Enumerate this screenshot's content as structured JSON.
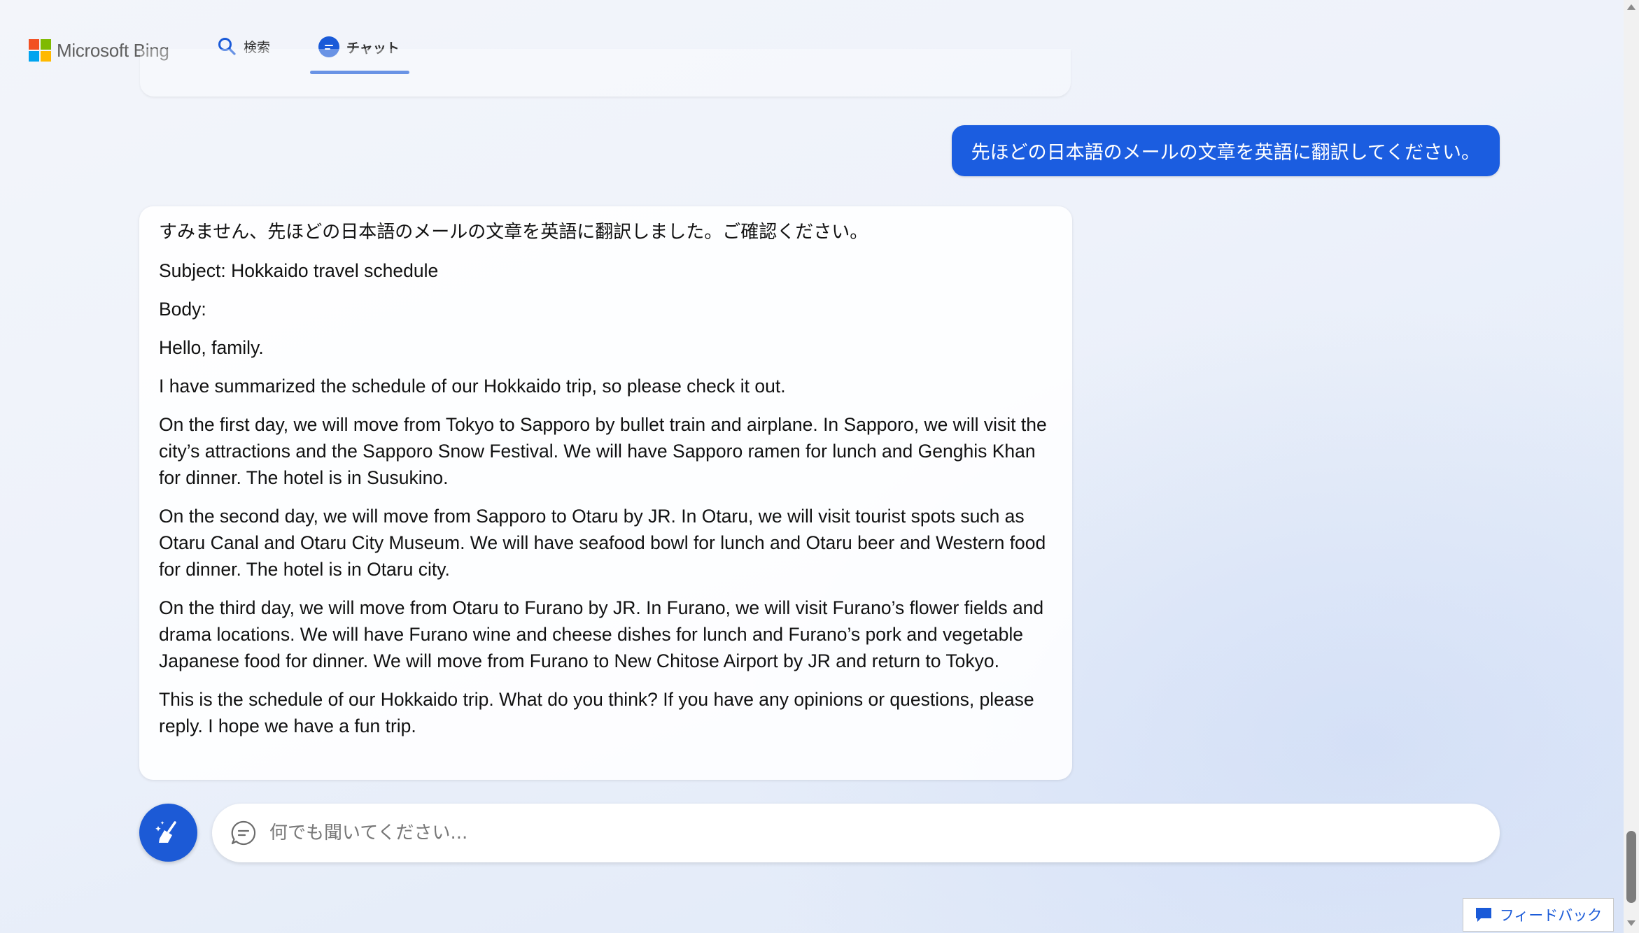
{
  "header": {
    "logo_text": "Microsoft Bing",
    "logo_colors": [
      "#f25022",
      "#7fba00",
      "#00a4ef",
      "#ffb900"
    ],
    "tabs": [
      {
        "label": "検索",
        "icon": "search-icon",
        "active": false
      },
      {
        "label": "チャット",
        "icon": "chat-icon",
        "active": true
      }
    ]
  },
  "conversation": {
    "user_message": "先ほどの日本語のメールの文章を英語に翻訳してください。",
    "bot_response": {
      "intro": "すみません、先ほどの日本語のメールの文章を英語に翻訳しました。ご確認ください。",
      "subject": "Subject: Hokkaido travel schedule",
      "body_label": "Body:",
      "greeting": "Hello, family.",
      "paragraphs": [
        "I have summarized the schedule of our Hokkaido trip, so please check it out.",
        "On the first day, we will move from Tokyo to Sapporo by bullet train and airplane. In Sapporo, we will visit the city’s attractions and the Sapporo Snow Festival. We will have Sapporo ramen for lunch and Genghis Khan for dinner. The hotel is in Susukino.",
        "On the second day, we will move from Sapporo to Otaru by JR. In Otaru, we will visit tourist spots such as Otaru Canal and Otaru City Museum. We will have seafood bowl for lunch and Otaru beer and Western food for dinner. The hotel is in Otaru city.",
        "On the third day, we will move from Otaru to Furano by JR. In Furano, we will visit Furano’s flower fields and drama locations. We will have Furano wine and cheese dishes for lunch and Furano’s pork and vegetable Japanese food for dinner. We will move from Furano to New Chitose Airport by JR and return to Tokyo.",
        "This is the schedule of our Hokkaido trip. What do you think? If you have any opinions or questions, please reply. I hope we have a fun trip."
      ]
    }
  },
  "input": {
    "placeholder": "何でも聞いてください...",
    "value": ""
  },
  "feedback": {
    "label": "フィードバック"
  },
  "colors": {
    "accent": "#1b5de0"
  }
}
